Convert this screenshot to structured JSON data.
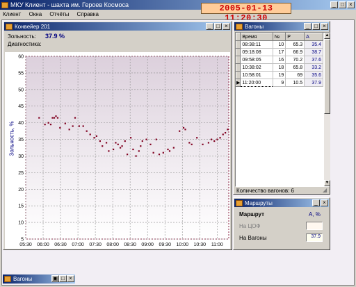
{
  "app": {
    "title": "МКУ Клиент - шахта им. Героев Космоса"
  },
  "datetime": "2005-01-13  11:20:30",
  "menu": [
    "Клиент",
    "Окна",
    "Отчёты",
    "Справка"
  ],
  "conveyor": {
    "title": "Конвейер 201",
    "ash_label": "Зольность:",
    "ash_value": "37.9 %",
    "diag_label": "Диагностика:"
  },
  "chart_data": {
    "type": "scatter",
    "ylabel": "Зольность, %",
    "ylim": [
      5,
      60
    ],
    "yticks": [
      5,
      10,
      15,
      20,
      25,
      30,
      35,
      40,
      45,
      50,
      55,
      60
    ],
    "xlim": [
      "05:30",
      "11:20"
    ],
    "xticks": [
      "05:30",
      "06:00",
      "06:30",
      "07:00",
      "07:30",
      "08:00",
      "08:30",
      "09:00",
      "09:30",
      "10:00",
      "10:30",
      "11:00"
    ],
    "grid": true,
    "series": [
      {
        "color": "#800020",
        "points": [
          [
            "05:53",
            41.5
          ],
          [
            "06:03",
            39.5
          ],
          [
            "06:09",
            40.0
          ],
          [
            "06:13",
            39.5
          ],
          [
            "06:16",
            41.5
          ],
          [
            "06:19",
            41.5
          ],
          [
            "06:22",
            42.0
          ],
          [
            "06:25",
            41.5
          ],
          [
            "06:29",
            38.5
          ],
          [
            "06:38",
            39.8
          ],
          [
            "06:45",
            38.0
          ],
          [
            "06:51",
            39.0
          ],
          [
            "06:55",
            41.5
          ],
          [
            "07:02",
            39.0
          ],
          [
            "07:09",
            39.0
          ],
          [
            "07:15",
            37.5
          ],
          [
            "07:21",
            36.5
          ],
          [
            "07:28",
            35.5
          ],
          [
            "07:32",
            36.0
          ],
          [
            "07:38",
            34.5
          ],
          [
            "07:42",
            33.0
          ],
          [
            "07:49",
            34.0
          ],
          [
            "07:53",
            31.5
          ],
          [
            "08:01",
            32.0
          ],
          [
            "08:05",
            34.0
          ],
          [
            "08:09",
            33.5
          ],
          [
            "08:13",
            32.5
          ],
          [
            "08:16",
            33.0
          ],
          [
            "08:21",
            34.5
          ],
          [
            "08:25",
            30.5
          ],
          [
            "08:31",
            35.5
          ],
          [
            "08:35",
            32.0
          ],
          [
            "08:40",
            30.0
          ],
          [
            "08:45",
            31.5
          ],
          [
            "08:48",
            33.0
          ],
          [
            "08:51",
            34.5
          ],
          [
            "08:58",
            35.0
          ],
          [
            "09:05",
            33.5
          ],
          [
            "09:10",
            31.0
          ],
          [
            "09:15",
            35.0
          ],
          [
            "09:20",
            30.5
          ],
          [
            "09:27",
            31.0
          ],
          [
            "09:35",
            32.0
          ],
          [
            "09:38",
            31.5
          ],
          [
            "09:45",
            32.5
          ],
          [
            "09:55",
            37.5
          ],
          [
            "10:02",
            38.5
          ],
          [
            "10:05",
            38.0
          ],
          [
            "10:12",
            34.0
          ],
          [
            "10:16",
            33.5
          ],
          [
            "10:25",
            35.5
          ],
          [
            "10:35",
            33.5
          ],
          [
            "10:45",
            34.0
          ],
          [
            "10:50",
            35.0
          ],
          [
            "10:55",
            34.5
          ],
          [
            "11:00",
            35.0
          ],
          [
            "11:05",
            35.5
          ],
          [
            "11:10",
            36.5
          ],
          [
            "11:14",
            37.0
          ],
          [
            "11:18",
            38.0
          ]
        ]
      }
    ]
  },
  "wagons": {
    "title": "Вагоны",
    "columns": [
      "Время",
      "№",
      "P",
      "A"
    ],
    "rows": [
      [
        "08:38:11",
        "10",
        "65.3",
        "35.4"
      ],
      [
        "09:18:08",
        "17",
        "66.9",
        "38.7"
      ],
      [
        "09:58:05",
        "16",
        "70.2",
        "37.6"
      ],
      [
        "10:38:02",
        "18",
        "65.8",
        "33.2"
      ],
      [
        "10:58:01",
        "19",
        "69",
        "35.6"
      ],
      [
        "11:20:00",
        "9",
        "10.5",
        "37.9"
      ]
    ],
    "count_label": "Количество вагонов: 6"
  },
  "routes": {
    "title": "Маршруты",
    "header_label": "Маршрут",
    "header_unit": "A, %",
    "items": [
      {
        "label": "На ЦОФ",
        "value": ""
      },
      {
        "label": "На Вагоны",
        "value": "37.9"
      }
    ]
  },
  "minimized": {
    "title": "Вагоны"
  }
}
